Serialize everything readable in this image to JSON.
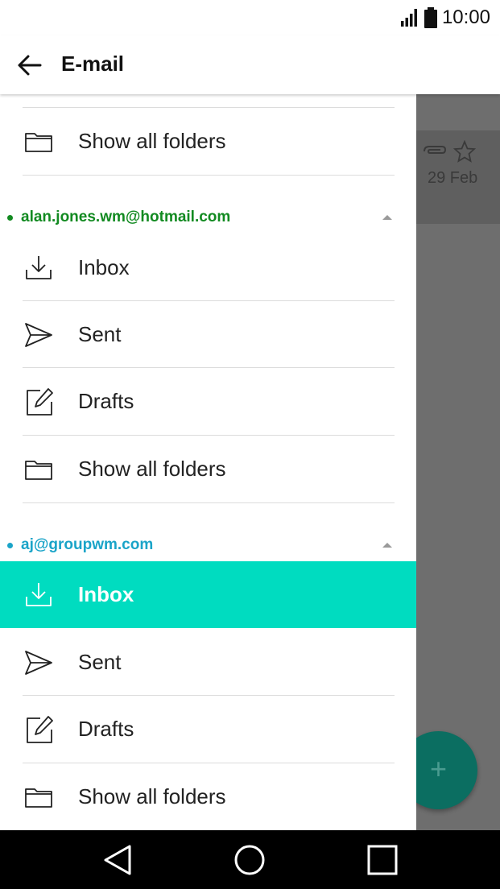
{
  "status_bar": {
    "time": "10:00"
  },
  "app_bar": {
    "title": "E-mail"
  },
  "background": {
    "date": "29 Feb"
  },
  "drawer": {
    "top_folder": {
      "label": "Show all folders"
    },
    "accounts": [
      {
        "email": "alan.jones.wm@hotmail.com",
        "color": "#128a21",
        "folders": [
          {
            "label": "Inbox",
            "icon": "inbox-icon"
          },
          {
            "label": "Sent",
            "icon": "sent-icon"
          },
          {
            "label": "Drafts",
            "icon": "drafts-icon"
          },
          {
            "label": "Show all folders",
            "icon": "folder-icon"
          }
        ]
      },
      {
        "email": "aj@groupwm.com",
        "color": "#1aa4c8",
        "folders": [
          {
            "label": "Inbox",
            "icon": "inbox-icon",
            "selected": true
          },
          {
            "label": "Sent",
            "icon": "sent-icon"
          },
          {
            "label": "Drafts",
            "icon": "drafts-icon"
          },
          {
            "label": "Show all folders",
            "icon": "folder-icon"
          }
        ]
      }
    ]
  },
  "colors": {
    "accent": "#00dcc0",
    "fab": "#0b6e61"
  }
}
